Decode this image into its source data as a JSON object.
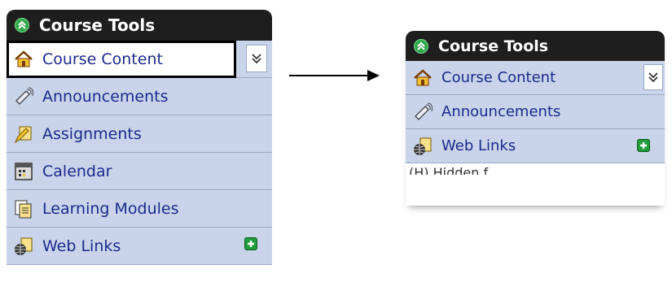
{
  "left_panel": {
    "title": "Course Tools",
    "items": [
      {
        "label": "Course Content",
        "icon": "house-icon"
      },
      {
        "label": "Announcements",
        "icon": "megaphone-icon"
      },
      {
        "label": "Assignments",
        "icon": "assignment-pencil-icon"
      },
      {
        "label": "Calendar",
        "icon": "calendar-icon"
      },
      {
        "label": "Learning Modules",
        "icon": "documents-icon"
      },
      {
        "label": "Web Links",
        "icon": "globe-page-icon"
      }
    ]
  },
  "right_panel": {
    "title": "Course Tools",
    "items": [
      {
        "label": "Course Content",
        "icon": "house-icon"
      },
      {
        "label": "Announcements",
        "icon": "megaphone-icon"
      },
      {
        "label": "Web Links",
        "icon": "globe-page-icon"
      }
    ],
    "cutoff_text": "(H)   Hidden f"
  },
  "colors": {
    "header_bg": "#1e1e1e",
    "item_bg": "#c9d4ea",
    "item_text": "#1b2a8c",
    "accent_green": "#2ea84a"
  }
}
